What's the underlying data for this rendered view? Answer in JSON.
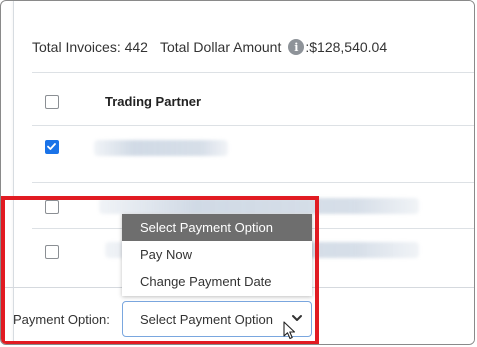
{
  "summary": {
    "total_invoices_label": "Total Invoices:",
    "total_invoices_value": "442",
    "total_amount_label": "Total Dollar Amount",
    "total_amount_value": ":$128,540.04",
    "info_icon": "info-icon"
  },
  "table": {
    "column_header": "Trading Partner",
    "rows": [
      {
        "checked": true
      },
      {
        "checked": false
      },
      {
        "checked": false
      }
    ]
  },
  "payment": {
    "label": "Payment Option:",
    "selected": "Select Payment Option",
    "options": [
      "Select Payment Option",
      "Pay Now",
      "Change Payment Date"
    ],
    "chevron_icon": "chevron-down-icon"
  },
  "colors": {
    "highlight": "#e11b22",
    "checkbox_checked": "#1a73e8",
    "dropdown_selected_bg": "#6e6e6e"
  }
}
